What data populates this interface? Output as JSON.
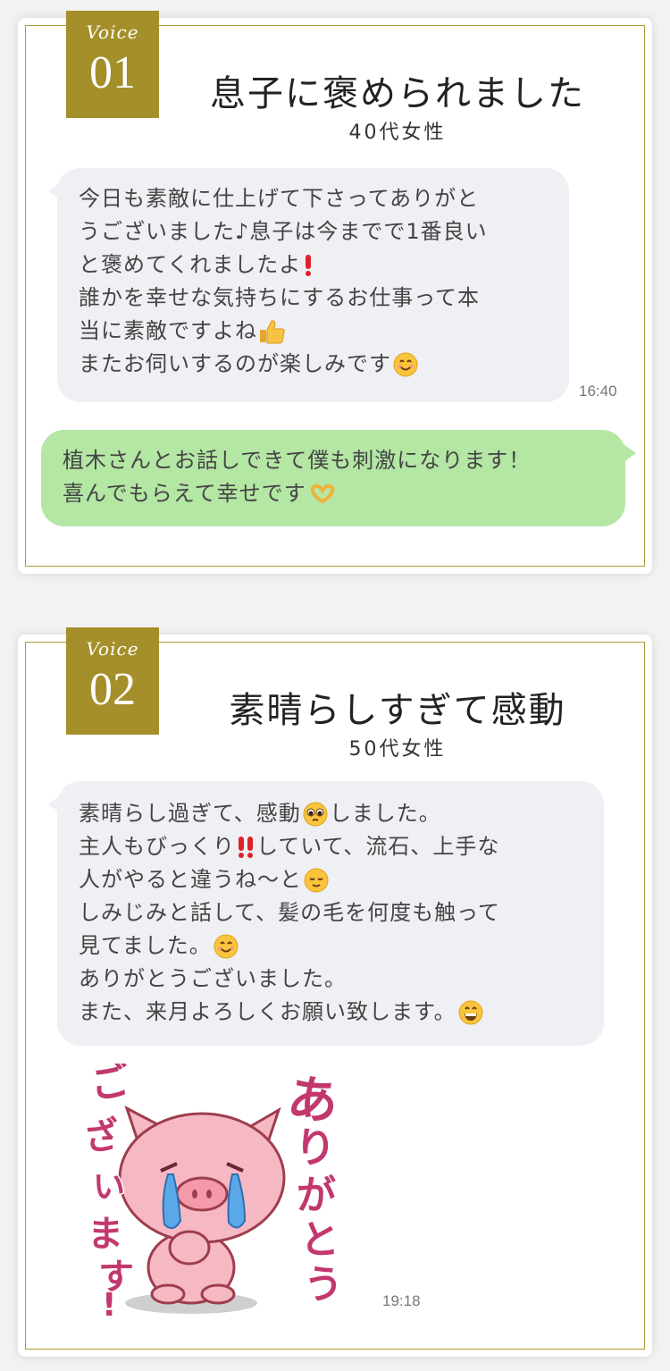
{
  "voices": [
    {
      "badge_word": "Voice",
      "badge_number": "01",
      "title": "息子に褒められました",
      "subtitle": "40代女性",
      "incoming": {
        "lines": [
          "今日も素敵に仕上げて下さってありがと",
          "うございました♪息子は今までで1番良い",
          "と褒めてくれましたよ",
          "誰かを幸せな気持ちにするお仕事って本",
          "当に素敵ですよね",
          "またお伺いするのが楽しみです"
        ],
        "emojis": [
          "exclamation-icon",
          "thumbs-up-icon",
          "smile-icon"
        ],
        "time": "16:40"
      },
      "outgoing": {
        "lines": [
          "植木さんとお話しできて僕も刺激になります！",
          "喜んでもらえて幸せです"
        ],
        "emojis": [
          "heart-hands-icon"
        ]
      }
    },
    {
      "badge_word": "Voice",
      "badge_number": "02",
      "title": "素晴らしすぎて感動",
      "subtitle": "50代女性",
      "incoming": {
        "lines": [
          "素晴らし過ぎて、感動",
          "しました。",
          "主人もびっくり",
          "していて、流石、上手な",
          "人がやると違うね〜と",
          "しみじみと話して、髪の毛を何度も触って",
          "見てました。",
          "ありがとうございました。",
          "また、来月よろしくお願い致します。"
        ],
        "emojis": [
          "pleading-face-icon",
          "double-exclamation-icon",
          "relieved-face-icon",
          "smile-icon",
          "grin-icon"
        ]
      },
      "sticker": {
        "name": "pig-crying-thank-you-sticker",
        "text": "ありがとうございます！",
        "time": "19:18"
      }
    }
  ],
  "colors": {
    "gold": "#a48f2a",
    "bubble_in": "#eef0f3",
    "bubble_out": "#b4e6a4",
    "pig_pink": "#f6b9c4",
    "sticker_text": "#c2386e"
  }
}
